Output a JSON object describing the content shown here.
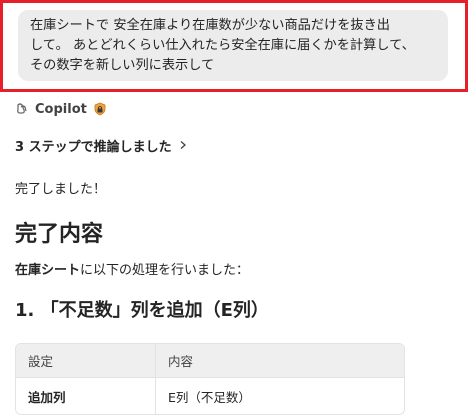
{
  "user_message": {
    "line1": "在庫シートで 安全在庫より在庫数が少ない商品だけを抜き出",
    "line2": "して。 あとどれくらい仕入れたら安全在庫に届くかを計算して、",
    "line3": "その数字を新しい列に表示して"
  },
  "assistant": {
    "name": "Copilot",
    "logo_icon": "copilot-logo-icon",
    "badge_icon": "lock-shield-icon",
    "reasoning_label": "3 ステップで推論しました",
    "reasoning_chevron": "chevron-right-icon",
    "done_text": "完了しました！",
    "section_title": "完了内容",
    "desc_bold": "在庫シート",
    "desc_rest": "に以下の処理を行いました：",
    "subsection_title": "1. 「不足数」列を追加（E列）",
    "table": {
      "headers": [
        "設定",
        "内容"
      ],
      "rows": [
        [
          "追加列",
          "E列（不足数）"
        ]
      ]
    }
  },
  "colors": {
    "highlight_border": "#e5202a",
    "bubble_bg": "#ececec",
    "table_header_bg": "#efefef"
  }
}
